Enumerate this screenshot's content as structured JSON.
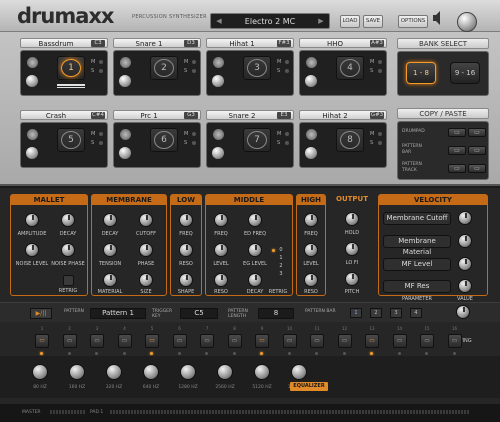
{
  "app": {
    "logo": "drumaxx",
    "subtitle": "PERCUSSION SYNTHESIZER"
  },
  "header": {
    "preset": "Electro 2 MC",
    "load": "LOAD",
    "save": "SAVE",
    "options": "OPTIONS"
  },
  "pads": [
    {
      "name": "Bassdrum",
      "note": "C3",
      "num": "1",
      "active": true
    },
    {
      "name": "Snare 1",
      "note": "D3",
      "num": "2"
    },
    {
      "name": "Hihat 1",
      "note": "F#3",
      "num": "3"
    },
    {
      "name": "HHO",
      "note": "A#3",
      "num": "4"
    },
    {
      "name": "Crash",
      "note": "C#4",
      "num": "5"
    },
    {
      "name": "Prc 1",
      "note": "G3",
      "num": "6"
    },
    {
      "name": "Snare 2",
      "note": "E3",
      "num": "7"
    },
    {
      "name": "Hihat 2",
      "note": "G#3",
      "num": "8"
    }
  ],
  "pad_ms": {
    "m": "M",
    "s": "S"
  },
  "bank": {
    "title": "BANK SELECT",
    "b1": "1 - 8",
    "b2": "9 - 16"
  },
  "copy": {
    "title": "COPY / PASTE",
    "rows": [
      "DRUMPAD",
      "PATTERN BAR",
      "PATTERN TRACK"
    ]
  },
  "mallet": {
    "title": "MALLET",
    "amplitude": "AMPLITUDE",
    "decay": "DECAY",
    "noise_level": "NOISE LEVEL",
    "noise_phase": "NOISE PHASE",
    "retrig": "RETRIG"
  },
  "membrane": {
    "title": "MEMBRANE",
    "decay": "DECAY",
    "cutoff": "CUTOFF",
    "tension": "TENSION",
    "phase": "PHASE",
    "material": "MATERIAL",
    "size": "SIZE"
  },
  "low": {
    "title": "LOW",
    "freq": "FREQ",
    "reso": "RESO",
    "shape": "SHAPE"
  },
  "middle": {
    "title": "MIDDLE",
    "freq": "FREQ",
    "ed_freq": "ED FREQ",
    "level": "LEVEL",
    "eg_level": "EG LEVEL",
    "reso": "RESO",
    "decay": "DECAY",
    "retrig": "RETRIG",
    "modes": [
      "0",
      "1",
      "2",
      "3"
    ]
  },
  "high": {
    "title": "HIGH",
    "freq": "FREQ",
    "level": "LEVEL",
    "reso": "RESO"
  },
  "output": {
    "title": "OUTPUT",
    "hold": "HOLD",
    "lofi": "LO FI",
    "pitch": "PITCH"
  },
  "velocity": {
    "title": "VELOCITY",
    "targets": [
      "Membrane Cutoff",
      "Membrane Material",
      "MF Level",
      "MF Res"
    ],
    "parameter": "PARAMETER",
    "value": "VALUE"
  },
  "sequencer": {
    "pattern_label": "PATTERN",
    "pattern_value": "Pattern 1",
    "trigger_label": "TRIGGER KEY",
    "trigger_value": "C5",
    "length_label": "PATTERN LENGTH",
    "length_value": "8",
    "bar_label": "PATTERN BAR",
    "bar_buttons": [
      "1",
      "2",
      "3",
      "4"
    ],
    "swing": "SWING",
    "steps": [
      "1",
      "2",
      "3",
      "4",
      "5",
      "6",
      "7",
      "8",
      "9",
      "10",
      "11",
      "12",
      "13",
      "14",
      "15",
      "16"
    ]
  },
  "equalizer": {
    "bands": [
      "80 HZ",
      "160 HZ",
      "320 HZ",
      "640 HZ",
      "1280 HZ",
      "2560 HZ",
      "5120 HZ",
      "10240 HZ"
    ],
    "button": "EQUALIZER"
  },
  "footer": {
    "master": "MASTER",
    "pad": "PAD 1"
  },
  "colors": {
    "accent": "#e08a2a",
    "panel_silver": "#bdbdbd",
    "panel_dark": "#262626"
  }
}
